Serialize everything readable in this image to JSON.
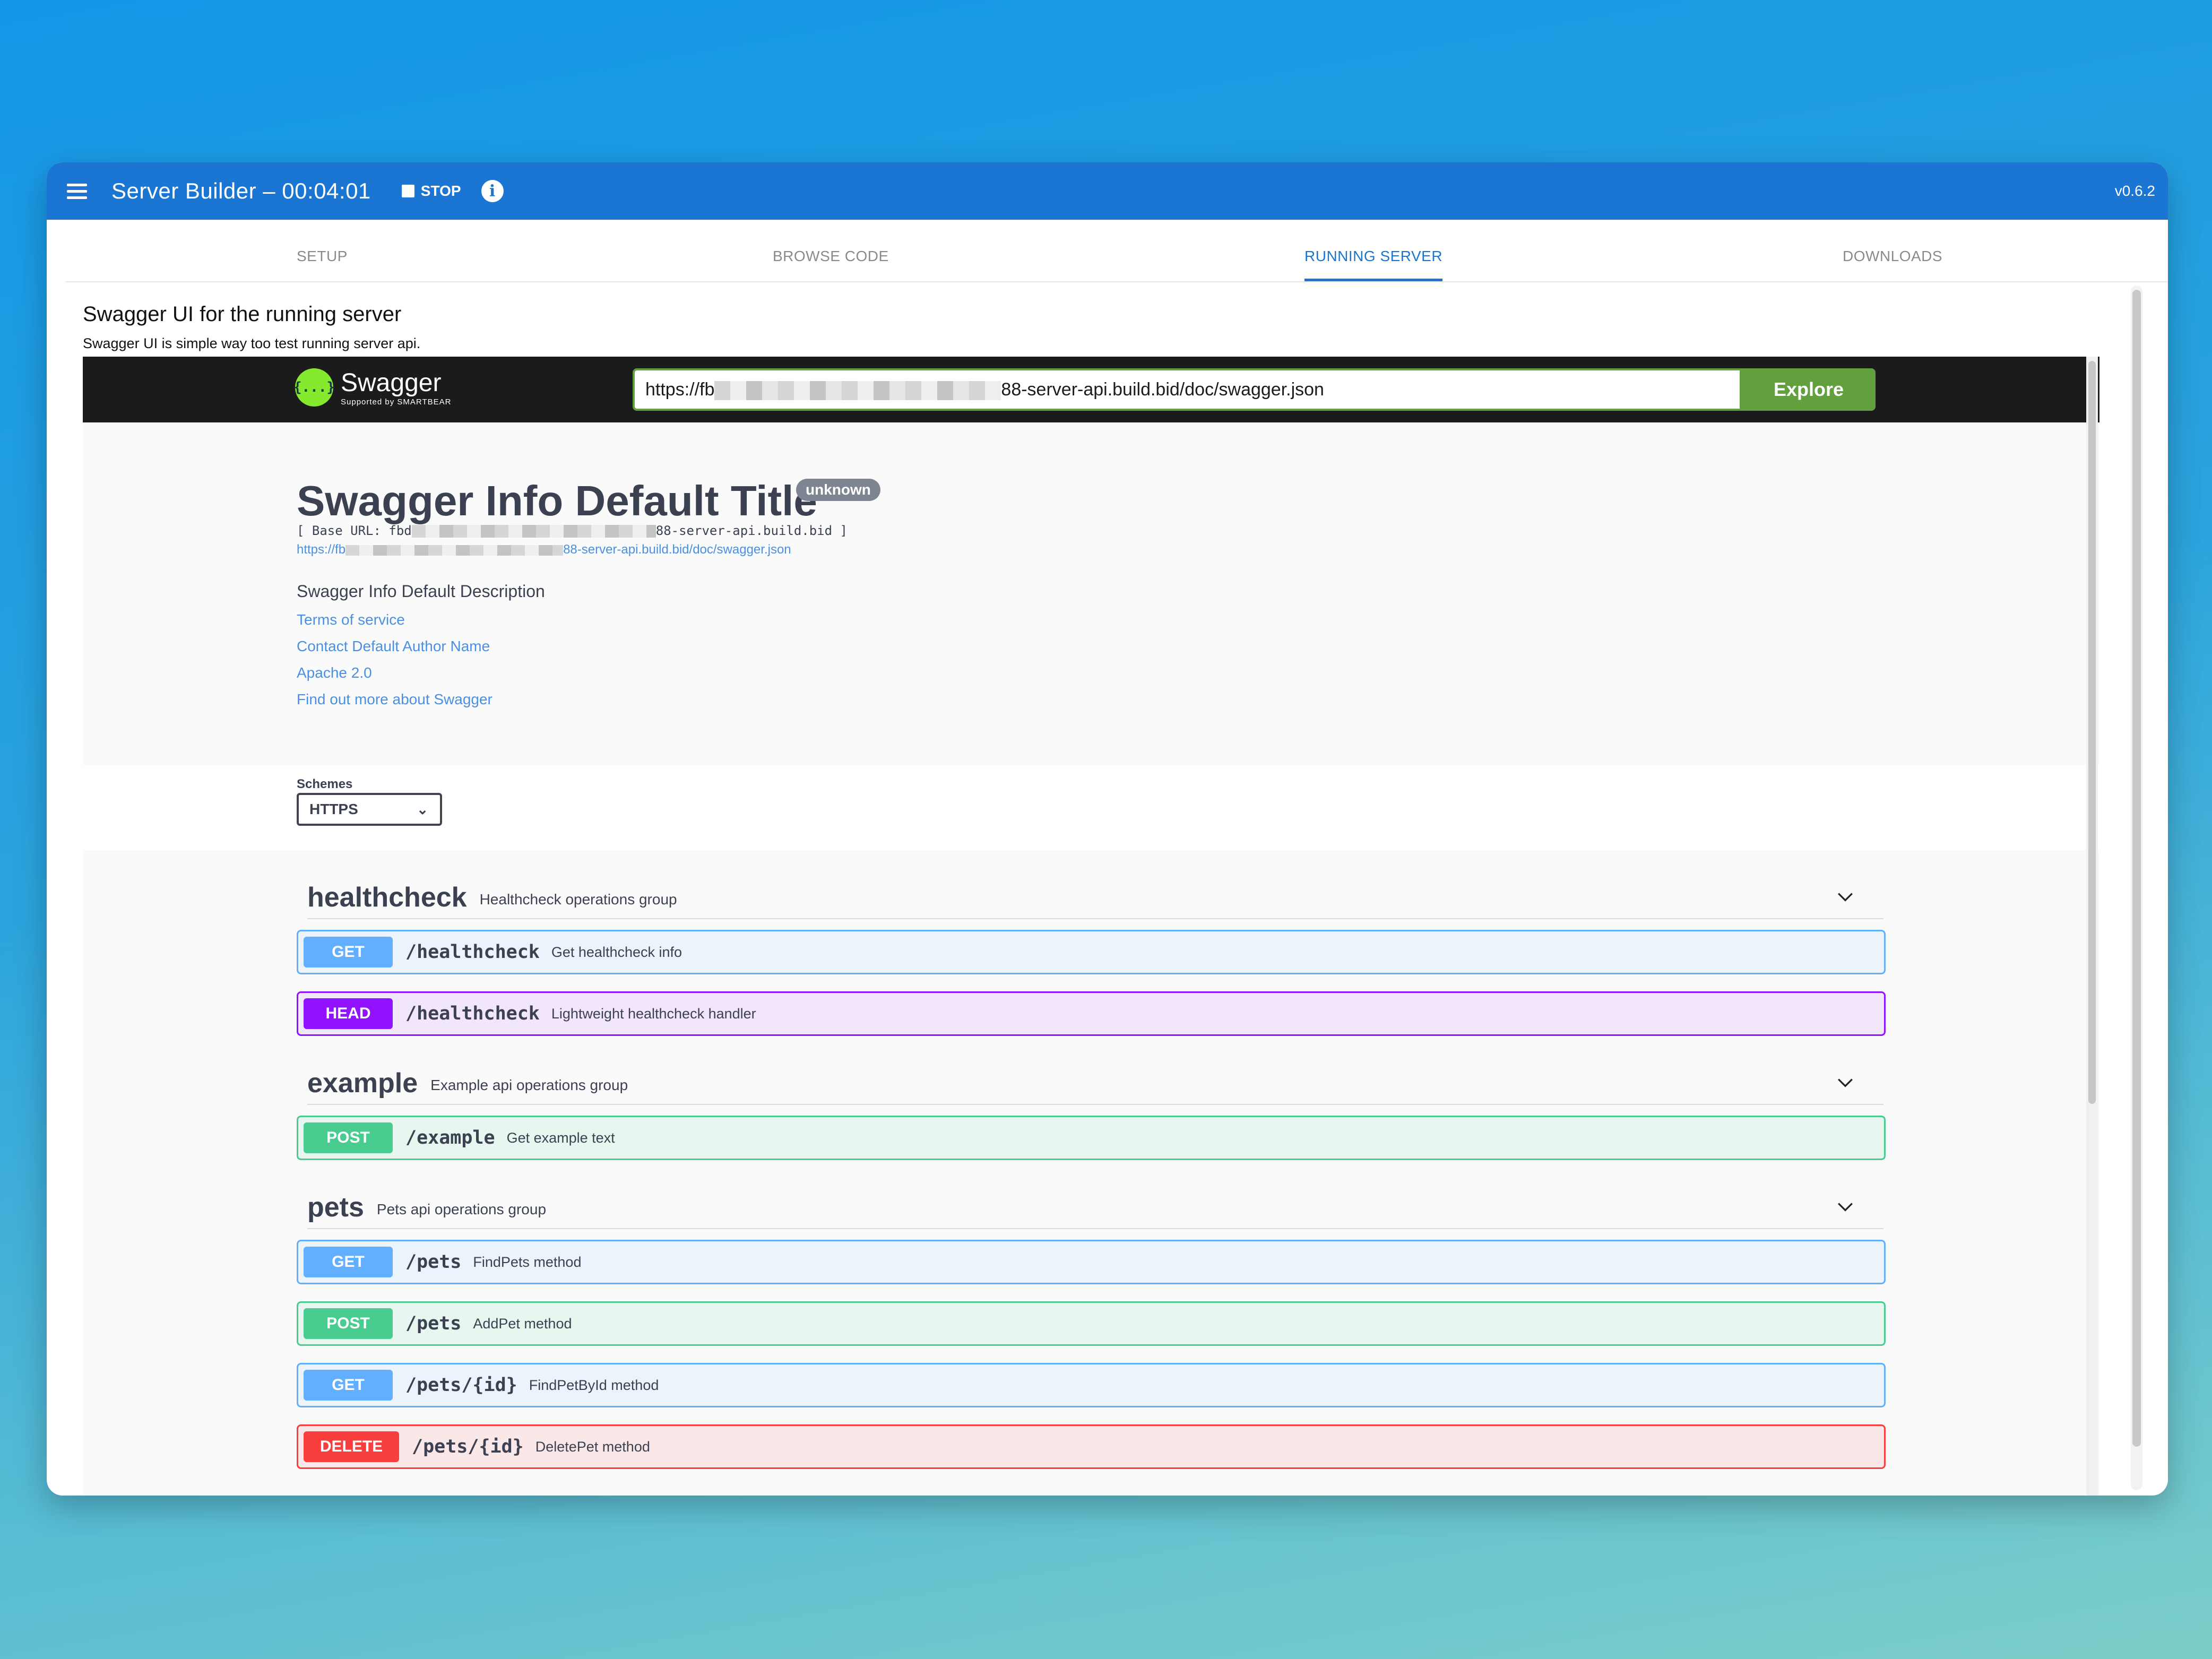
{
  "appbar": {
    "title": "Server Builder – 00:04:01",
    "stop_label": "STOP",
    "info_icon": "i",
    "version": "v0.6.2"
  },
  "tabs": [
    {
      "label": "SETUP"
    },
    {
      "label": "BROWSE CODE"
    },
    {
      "label": "RUNNING SERVER"
    },
    {
      "label": "DOWNLOADS"
    }
  ],
  "page": {
    "title": "Swagger UI for the running server",
    "subtitle": "Swagger UI is simple way too test running server api."
  },
  "swagger": {
    "logo_mark": "{...}",
    "logo_name": "Swagger",
    "logo_sub": "Supported by SMARTBEAR",
    "url_prefix": "https://fb",
    "url_suffix": "88-server-api.build.bid/doc/swagger.json",
    "explore_label": "Explore",
    "info": {
      "title": "Swagger Info Default Title",
      "version_badge": "unknown",
      "base_url_prefix": "[ Base URL: fbd",
      "base_url_suffix": "88-server-api.build.bid ]",
      "spec_url_prefix": "https://fb",
      "spec_url_suffix": "88-server-api.build.bid/doc/swagger.json",
      "description": "Swagger Info Default Description",
      "links": [
        "Terms of service",
        "Contact Default Author Name",
        "Apache 2.0",
        "Find out more about Swagger"
      ]
    },
    "schemes": {
      "label": "Schemes",
      "selected": "HTTPS"
    },
    "groups": [
      {
        "name": "healthcheck",
        "description": "Healthcheck operations group",
        "operations": [
          {
            "method": "GET",
            "path": "/healthcheck",
            "summary": "Get healthcheck info"
          },
          {
            "method": "HEAD",
            "path": "/healthcheck",
            "summary": "Lightweight healthcheck handler"
          }
        ]
      },
      {
        "name": "example",
        "description": "Example api operations group",
        "operations": [
          {
            "method": "POST",
            "path": "/example",
            "summary": "Get example text"
          }
        ]
      },
      {
        "name": "pets",
        "description": "Pets api operations group",
        "operations": [
          {
            "method": "GET",
            "path": "/pets",
            "summary": "FindPets method"
          },
          {
            "method": "POST",
            "path": "/pets",
            "summary": "AddPet method"
          },
          {
            "method": "GET",
            "path": "/pets/{id}",
            "summary": "FindPetById method"
          },
          {
            "method": "DELETE",
            "path": "/pets/{id}",
            "summary": "DeletePet method"
          }
        ]
      }
    ]
  },
  "colors": {
    "appbar": "#1b75d2",
    "get": "#61affe",
    "head": "#9012fe",
    "post": "#49cc90",
    "delete": "#f93e3e",
    "explore": "#62a03f"
  }
}
